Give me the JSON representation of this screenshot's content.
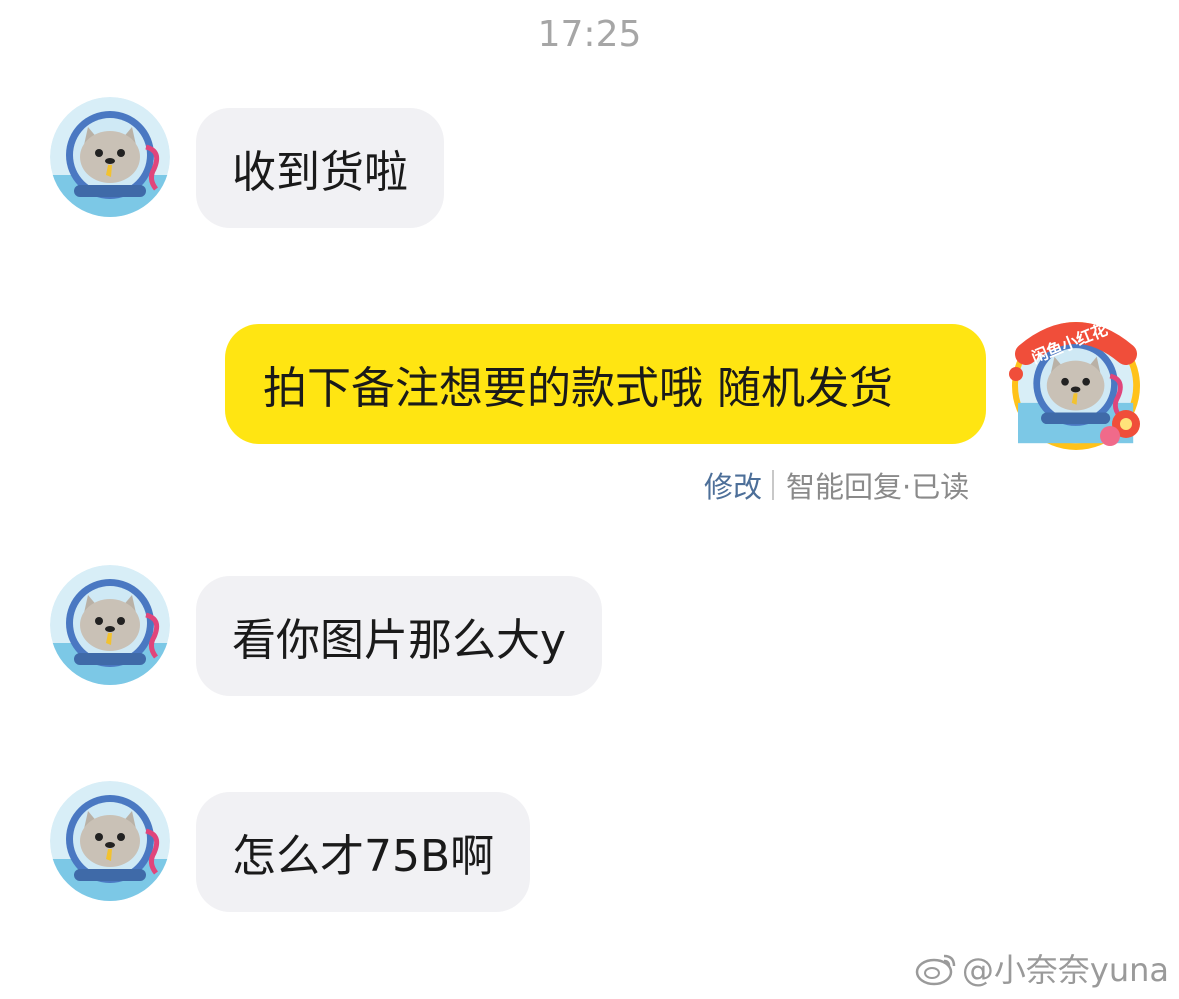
{
  "timestamp": "17:25",
  "messages": [
    {
      "side": "incoming",
      "text": "收到货啦"
    },
    {
      "side": "outgoing",
      "text": "拍下备注想要的款式哦 随机发货",
      "edit_label": "修改",
      "status_text": "智能回复·已读"
    },
    {
      "side": "incoming",
      "text": "看你图片那么大y"
    },
    {
      "side": "incoming",
      "text": "怎么才75B啊"
    }
  ],
  "self_avatar_badge": "闲鱼小红花",
  "watermark": {
    "handle": "@小奈奈yuna",
    "icon": "weibo-icon"
  },
  "colors": {
    "outgoing_bubble": "#ffe512",
    "incoming_bubble": "#f1f1f4",
    "edit_link": "#4d6f99",
    "timestamp": "#a6a6a6"
  }
}
